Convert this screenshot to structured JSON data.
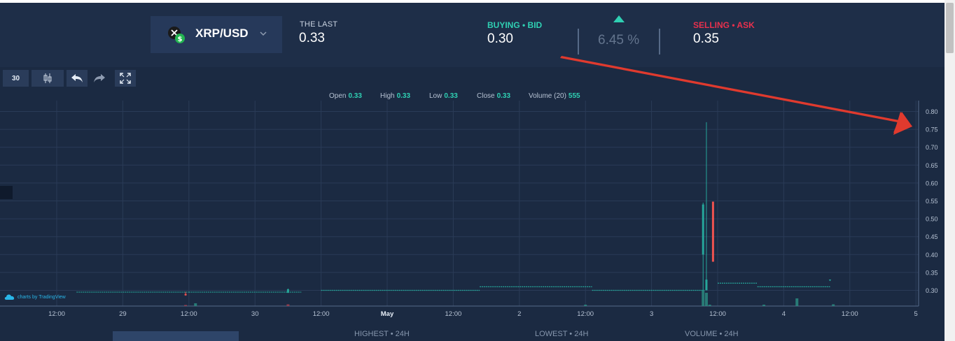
{
  "header": {
    "pair_label": "XRP/USD",
    "last_title": "THE LAST",
    "last_value": "0.33",
    "bid_title": "BUYING • BID",
    "bid_value": "0.30",
    "spread_value": "6.45 %",
    "ask_title": "SELLING • ASK",
    "ask_value": "0.35"
  },
  "toolbar": {
    "interval_label": "30"
  },
  "ohlc": {
    "open_label": "Open",
    "open_value": "0.33",
    "high_label": "High",
    "high_value": "0.33",
    "low_label": "Low",
    "low_value": "0.33",
    "close_label": "Close",
    "close_value": "0.33",
    "volume_label": "Volume (20)",
    "volume_value": "555"
  },
  "chart_data": {
    "type": "candlestick",
    "x_tick_labels": [
      "12:00",
      "29",
      "12:00",
      "30",
      "12:00",
      "May",
      "12:00",
      "2",
      "12:00",
      "3",
      "12:00",
      "4",
      "12:00",
      "5"
    ],
    "y_tick_labels": [
      "0.80",
      "0.75",
      "0.70",
      "0.65",
      "0.60",
      "0.55",
      "0.50",
      "0.45",
      "0.40",
      "0.35",
      "0.30"
    ],
    "ylim": [
      0.255,
      0.81
    ],
    "price_levels": [
      {
        "from_tick": 0.3,
        "to_tick": 2.0,
        "price": 0.295
      },
      {
        "from_tick": 2.0,
        "to_tick": 3.7,
        "price": 0.295
      },
      {
        "from_tick": 4.0,
        "to_tick": 6.4,
        "price": 0.3
      },
      {
        "from_tick": 6.4,
        "to_tick": 8.1,
        "price": 0.31
      },
      {
        "from_tick": 8.1,
        "to_tick": 9.8,
        "price": 0.3
      },
      {
        "from_tick": 10.0,
        "to_tick": 10.6,
        "price": 0.32
      },
      {
        "from_tick": 10.6,
        "to_tick": 11.7,
        "price": 0.31
      }
    ],
    "candles": [
      {
        "tick": 1.95,
        "open": 0.29,
        "high": 0.296,
        "low": 0.285,
        "close": 0.286,
        "dir": "down"
      },
      {
        "tick": 3.5,
        "open": 0.293,
        "high": 0.305,
        "low": 0.293,
        "close": 0.303,
        "dir": "up"
      },
      {
        "tick": 9.78,
        "open": 0.4,
        "high": 0.545,
        "low": 0.3,
        "close": 0.54,
        "dir": "up"
      },
      {
        "tick": 9.83,
        "open": 0.3,
        "high": 0.77,
        "low": 0.3,
        "close": 0.33,
        "dir": "up"
      },
      {
        "tick": 9.93,
        "open": 0.548,
        "high": 0.548,
        "low": 0.38,
        "close": 0.38,
        "dir": "down"
      },
      {
        "tick": 11.7,
        "open": 0.328,
        "high": 0.33,
        "low": 0.326,
        "close": 0.33,
        "dir": "up"
      }
    ],
    "volume_bars": [
      {
        "tick": 1.95,
        "value": 0.15,
        "dir": "down"
      },
      {
        "tick": 2.1,
        "value": 0.4,
        "dir": "up"
      },
      {
        "tick": 3.5,
        "value": 0.25,
        "dir": "down"
      },
      {
        "tick": 8.0,
        "value": 0.2,
        "dir": "up"
      },
      {
        "tick": 9.78,
        "value": 2.2,
        "dir": "up"
      },
      {
        "tick": 9.83,
        "value": 1.9,
        "dir": "up"
      },
      {
        "tick": 9.88,
        "value": 0.2,
        "dir": "up"
      },
      {
        "tick": 10.7,
        "value": 0.2,
        "dir": "up"
      },
      {
        "tick": 11.2,
        "value": 1.1,
        "dir": "up"
      },
      {
        "tick": 11.75,
        "value": 0.25,
        "dir": "up"
      }
    ],
    "grid": true
  },
  "stats": {
    "highest_label": "HIGHEST • 24H",
    "lowest_label": "LOWEST • 24H",
    "volume_label": "VOLUME • 24H"
  },
  "branding": {
    "tv_label": "charts by TradingView"
  },
  "colors": {
    "up": "#26a69a",
    "down": "#ef5350",
    "accent": "#2fd0b3",
    "ask": "#e8304d",
    "background": "#1b2a42"
  }
}
